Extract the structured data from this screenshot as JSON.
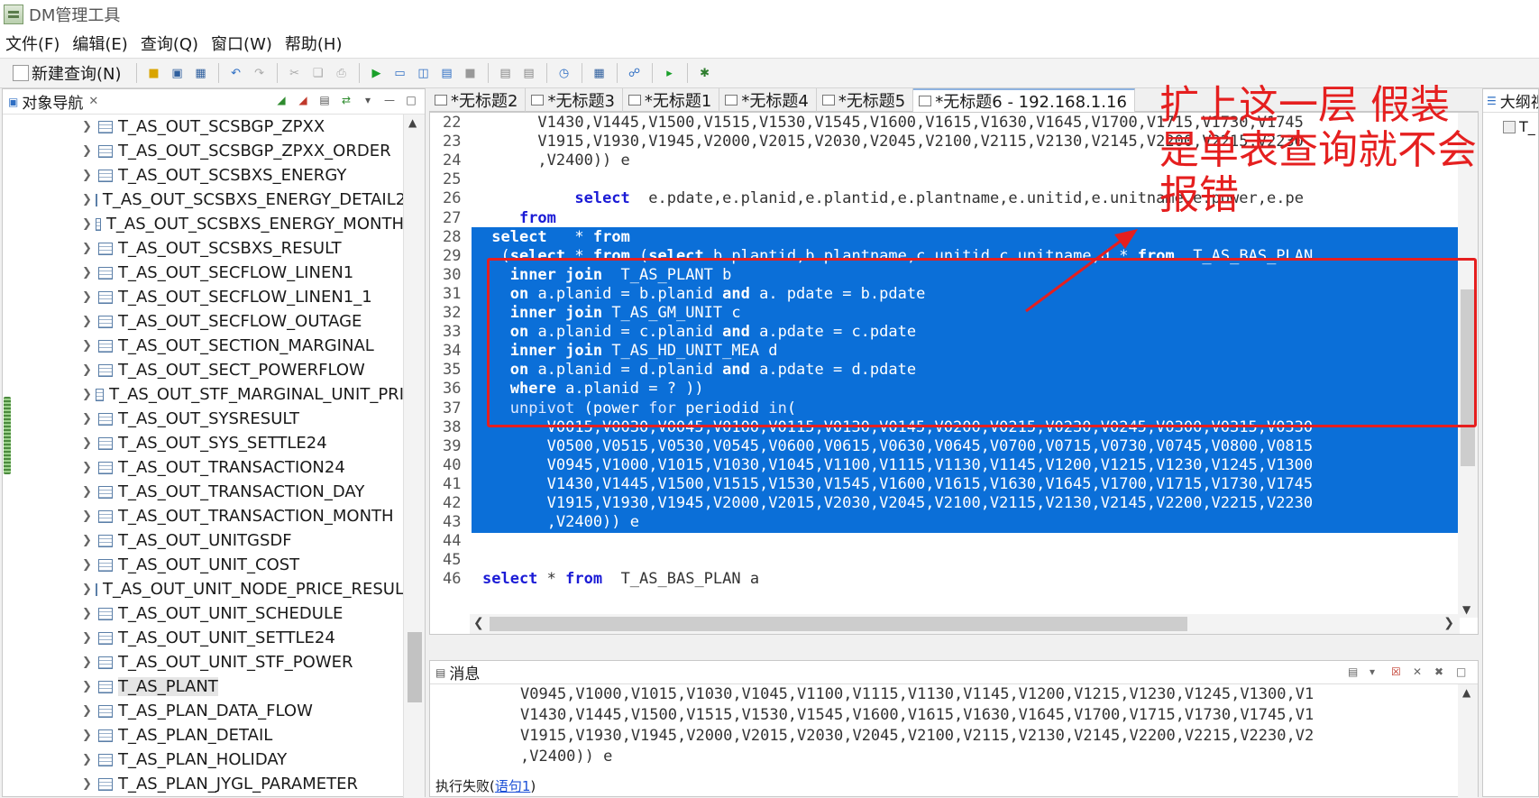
{
  "window": {
    "title": "DM管理工具"
  },
  "menu": [
    "文件(F)",
    "编辑(E)",
    "查询(Q)",
    "窗口(W)",
    "帮助(H)"
  ],
  "toolbar": {
    "new_query": "新建查询(N)"
  },
  "navigator": {
    "title": "对象导航",
    "items": [
      "T_AS_OUT_SCSBGP_ZPXX",
      "T_AS_OUT_SCSBGP_ZPXX_ORDER",
      "T_AS_OUT_SCSBXS_ENERGY",
      "T_AS_OUT_SCSBXS_ENERGY_DETAIL2",
      "T_AS_OUT_SCSBXS_ENERGY_MONTH",
      "T_AS_OUT_SCSBXS_RESULT",
      "T_AS_OUT_SECFLOW_LINEN1",
      "T_AS_OUT_SECFLOW_LINEN1_1",
      "T_AS_OUT_SECFLOW_OUTAGE",
      "T_AS_OUT_SECTION_MARGINAL",
      "T_AS_OUT_SECT_POWERFLOW",
      "T_AS_OUT_STF_MARGINAL_UNIT_PRI",
      "T_AS_OUT_SYSRESULT",
      "T_AS_OUT_SYS_SETTLE24",
      "T_AS_OUT_TRANSACTION24",
      "T_AS_OUT_TRANSACTION_DAY",
      "T_AS_OUT_TRANSACTION_MONTH",
      "T_AS_OUT_UNITGSDF",
      "T_AS_OUT_UNIT_COST",
      "T_AS_OUT_UNIT_NODE_PRICE_RESUL",
      "T_AS_OUT_UNIT_SCHEDULE",
      "T_AS_OUT_UNIT_SETTLE24",
      "T_AS_OUT_UNIT_STF_POWER",
      "T_AS_PLANT",
      "T_AS_PLAN_DATA_FLOW",
      "T_AS_PLAN_DETAIL",
      "T_AS_PLAN_HOLIDAY",
      "T_AS_PLAN_JYGL_PARAMETER"
    ],
    "selected_index": 23
  },
  "tabs": [
    "*无标题2",
    "*无标题3",
    "*无标题1",
    "*无标题4",
    "*无标题5",
    "*无标题6 - 192.168.1.16"
  ],
  "active_tab": 5,
  "outline": {
    "title": "大纲视图",
    "item": "T_"
  },
  "editor_lines": [
    {
      "n": "22",
      "hl": false,
      "text": "      V1430,V1445,V1500,V1515,V1530,V1545,V1600,V1615,V1630,V1645,V1700,V1715,V1730,V1745"
    },
    {
      "n": "23",
      "hl": false,
      "text": "      V1915,V1930,V1945,V2000,V2015,V2030,V2045,V2100,V2115,V2130,V2145,V2200,V2215,V2230"
    },
    {
      "n": "24",
      "hl": false,
      "text": "      ,V2400)) e"
    },
    {
      "n": "25",
      "hl": false,
      "text": ""
    },
    {
      "n": "26",
      "hl": false,
      "text": "          select  e.pdate,e.planid,e.plantid,e.plantname,e.unitid,e.unitname,e.power,e.pe"
    },
    {
      "n": "27",
      "hl": false,
      "text": "    from"
    },
    {
      "n": "28",
      "hl": true,
      "text": " select   * from"
    },
    {
      "n": "29",
      "hl": true,
      "text": "  (select * from (select b.plantid,b.plantname,c.unitid c.unitname,d.* from  T_AS_BAS_PLAN"
    },
    {
      "n": "30",
      "hl": true,
      "text": "   inner join  T_AS_PLANT b"
    },
    {
      "n": "31",
      "hl": true,
      "text": "   on a.planid = b.planid and a. pdate = b.pdate"
    },
    {
      "n": "32",
      "hl": true,
      "text": "   inner join T_AS_GM_UNIT c"
    },
    {
      "n": "33",
      "hl": true,
      "text": "   on a.planid = c.planid and a.pdate = c.pdate"
    },
    {
      "n": "34",
      "hl": true,
      "text": "   inner join T_AS_HD_UNIT_MEA d"
    },
    {
      "n": "35",
      "hl": true,
      "text": "   on a.planid = d.planid and a.pdate = d.pdate"
    },
    {
      "n": "36",
      "hl": true,
      "text": "   where a.planid = ? ))"
    },
    {
      "n": "37",
      "hl": true,
      "text": "   unpivot (power for periodid in("
    },
    {
      "n": "38",
      "hl": true,
      "text": "       V0015,V0030,V0045,V0100,V0115,V0130,V0145,V0200,V0215,V0230,V0245,V0300,V0315,V0330"
    },
    {
      "n": "39",
      "hl": true,
      "text": "       V0500,V0515,V0530,V0545,V0600,V0615,V0630,V0645,V0700,V0715,V0730,V0745,V0800,V0815"
    },
    {
      "n": "40",
      "hl": true,
      "text": "       V0945,V1000,V1015,V1030,V1045,V1100,V1115,V1130,V1145,V1200,V1215,V1230,V1245,V1300"
    },
    {
      "n": "41",
      "hl": true,
      "text": "       V1430,V1445,V1500,V1515,V1530,V1545,V1600,V1615,V1630,V1645,V1700,V1715,V1730,V1745"
    },
    {
      "n": "42",
      "hl": true,
      "text": "       V1915,V1930,V1945,V2000,V2015,V2030,V2045,V2100,V2115,V2130,V2145,V2200,V2215,V2230"
    },
    {
      "n": "43",
      "hl": true,
      "text": "       ,V2400)) e"
    },
    {
      "n": "44",
      "hl": false,
      "text": ""
    },
    {
      "n": "45",
      "hl": false,
      "text": ""
    },
    {
      "n": "46",
      "hl": false,
      "text": "select * from  T_AS_BAS_PLAN a"
    }
  ],
  "messages": {
    "title": "消息",
    "lines": [
      "V0945,V1000,V1015,V1030,V1045,V1100,V1115,V1130,V1145,V1200,V1215,V1230,V1245,V1300,V1",
      "V1430,V1445,V1500,V1515,V1530,V1545,V1600,V1615,V1630,V1645,V1700,V1715,V1730,V1745,V1",
      "V1915,V1930,V1945,V2000,V2015,V2030,V2045,V2100,V2115,V2130,V2145,V2200,V2215,V2230,V2",
      ",V2400)) e"
    ],
    "status_prefix": "执行失败(",
    "status_link": "语句1",
    "status_suffix": ")"
  },
  "annotation": {
    "line1": "扩上这一层 假装",
    "line2": "是单表查询就不会",
    "line3": "报错",
    "color": "#e51f1f"
  }
}
